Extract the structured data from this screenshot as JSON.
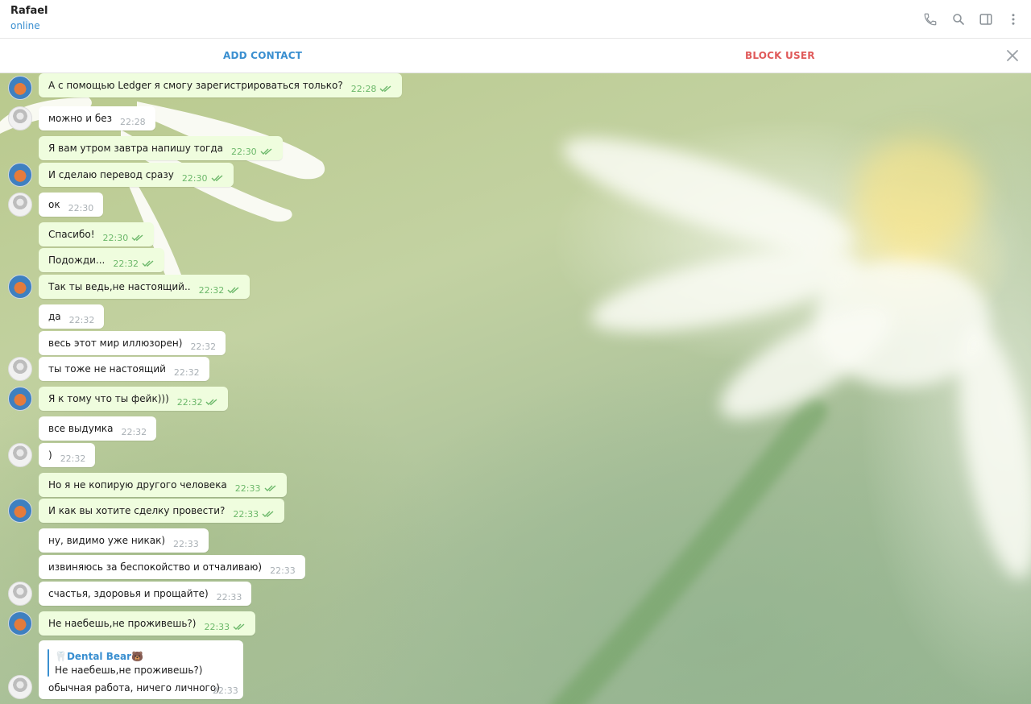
{
  "header": {
    "peer_name": "Rafael",
    "peer_status": "online",
    "icons": [
      "phone-icon",
      "search-icon",
      "sidebar-toggle-icon",
      "more-vertical-icon"
    ]
  },
  "actionbar": {
    "add_contact": "ADD CONTACT",
    "block_user": "BLOCK USER",
    "close_icon": "close-icon"
  },
  "colors": {
    "accent": "#3a8fd0",
    "danger": "#e05a5a",
    "outgoing_bubble": "#effdde",
    "incoming_bubble": "#ffffff",
    "read_ticks": "#6cb86a"
  },
  "messages": [
    {
      "dir": "out",
      "text": "А с помощью Ledger я смогу зарегистрироваться только?",
      "time": "22:28",
      "avatar": "bear"
    },
    {
      "dir": "in",
      "text": "можно и без",
      "time": "22:28",
      "avatar": "human"
    },
    {
      "dir": "out",
      "text": "Я вам утром завтра напишу тогда",
      "time": "22:30",
      "avatar": ""
    },
    {
      "dir": "out",
      "text": "И сделаю перевод сразу",
      "time": "22:30",
      "avatar": "bear"
    },
    {
      "dir": "in",
      "text": "ок",
      "time": "22:30",
      "avatar": "human"
    },
    {
      "dir": "out",
      "text": "Спасибо!",
      "time": "22:30",
      "avatar": ""
    },
    {
      "dir": "out",
      "text": "Подожди...",
      "time": "22:32",
      "avatar": ""
    },
    {
      "dir": "out",
      "text": "Так ты ведь,не настоящий..",
      "time": "22:32",
      "avatar": "bear"
    },
    {
      "dir": "in",
      "text": "да",
      "time": "22:32",
      "avatar": ""
    },
    {
      "dir": "in",
      "text": "весь этот мир иллюзорен)",
      "time": "22:32",
      "avatar": ""
    },
    {
      "dir": "in",
      "text": "ты тоже не настоящий",
      "time": "22:32",
      "avatar": "human"
    },
    {
      "dir": "out",
      "text": "Я к тому что ты фейк)))",
      "time": "22:32",
      "avatar": "bear"
    },
    {
      "dir": "in",
      "text": "все выдумка",
      "time": "22:32",
      "avatar": ""
    },
    {
      "dir": "in",
      "text": ")",
      "time": "22:32",
      "avatar": "human"
    },
    {
      "dir": "out",
      "text": "Но я не копирую другого человека",
      "time": "22:33",
      "avatar": ""
    },
    {
      "dir": "out",
      "text": "И как вы хотите сделку провести?",
      "time": "22:33",
      "avatar": "bear"
    },
    {
      "dir": "in",
      "text": "ну, видимо уже никак)",
      "time": "22:33",
      "avatar": ""
    },
    {
      "dir": "in",
      "text": "извиняюсь за беспокойство и отчаливаю)",
      "time": "22:33",
      "avatar": ""
    },
    {
      "dir": "in",
      "text": "счастья, здоровья и прощайте)",
      "time": "22:33",
      "avatar": "human"
    },
    {
      "dir": "out",
      "text": "Не наебешь,не проживешь?)",
      "time": "22:33",
      "avatar": "bear"
    }
  ],
  "reply_message": {
    "author": "🦷Dental Bear🐻",
    "quoted_text": "Не наебешь,не проживешь?)",
    "text": "обычная работа, ничего личного)",
    "time": "22:33",
    "avatar": "human"
  }
}
